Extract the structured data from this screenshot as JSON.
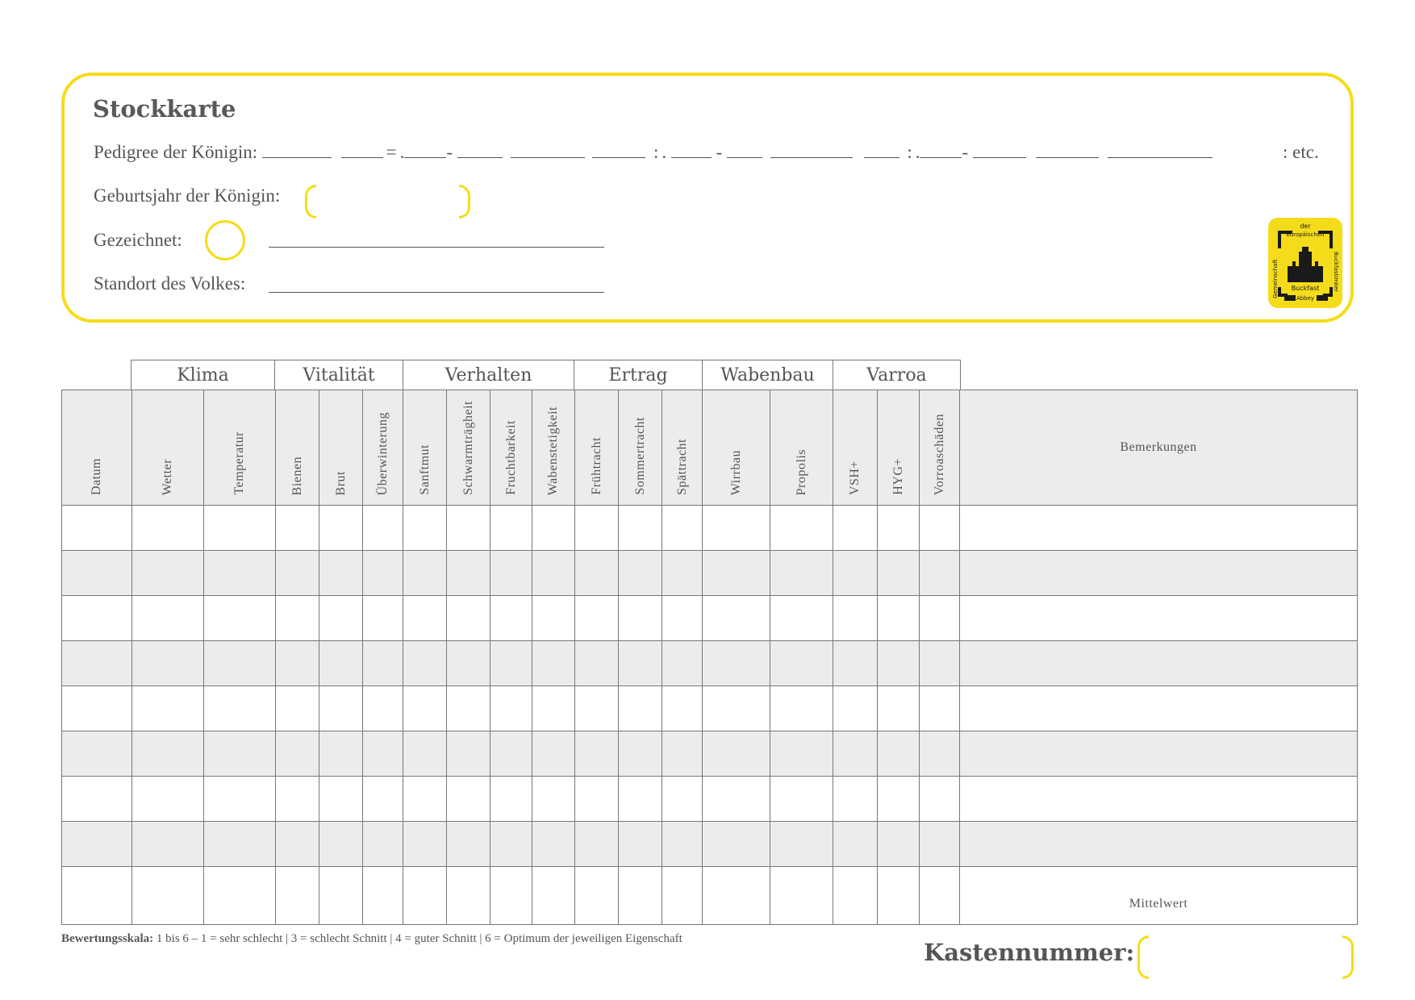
{
  "header": {
    "title": "Stockkarte",
    "pedigree_label": "Pedigree der Königin:",
    "pedigree_separators": [
      "=",
      ".",
      "-",
      ":",
      ".",
      "-",
      ":",
      ".",
      "-"
    ],
    "pedigree_etc": ": etc.",
    "birth_year_label": "Geburtsjahr der Königin:",
    "marked_label": "Gezeichnet:",
    "location_label": "Standort des Volkes:"
  },
  "logo": {
    "text_top": "der",
    "text_top2": "europäischen",
    "text_left": "Gemeinschaft",
    "text_right": "Buckfastimker",
    "text_bottom": "Buckfast",
    "text_bottom2": "Abbey",
    "color": "#f5dc1a"
  },
  "table": {
    "groups": [
      "Klima",
      "Vitalität",
      "Verhalten",
      "Ertrag",
      "Wabenbau",
      "Varroa"
    ],
    "columns": [
      "Datum",
      "Wetter",
      "Temperatur",
      "Bienen",
      "Brut",
      "Überwinterung",
      "Sanftmut",
      "Schwarmträgheit",
      "Fruchtbarkeit",
      "Wabenstetigkeit",
      "Frühtracht",
      "Sommertracht",
      "Spättracht",
      "Wirrbau",
      "Propolis",
      "VSH+",
      "HYG+",
      "Vorroaschäden"
    ],
    "remarks_header": "Bemerkungen",
    "mean_label": "Mittelwert",
    "rows": 9
  },
  "footer": {
    "scale_label": "Bewertungsskala:",
    "scale_text": " 1 bis 6  –  1 = sehr schlecht  |  3 = schlecht Schnitt  |  4 = guter Schnitt  |  6 = Optimum der jeweiligen Eigenschaft",
    "box_number_label": "Kastennummer:"
  },
  "colors": {
    "accent": "#f5dc1a",
    "text": "#555555",
    "shade": "#ececec"
  }
}
